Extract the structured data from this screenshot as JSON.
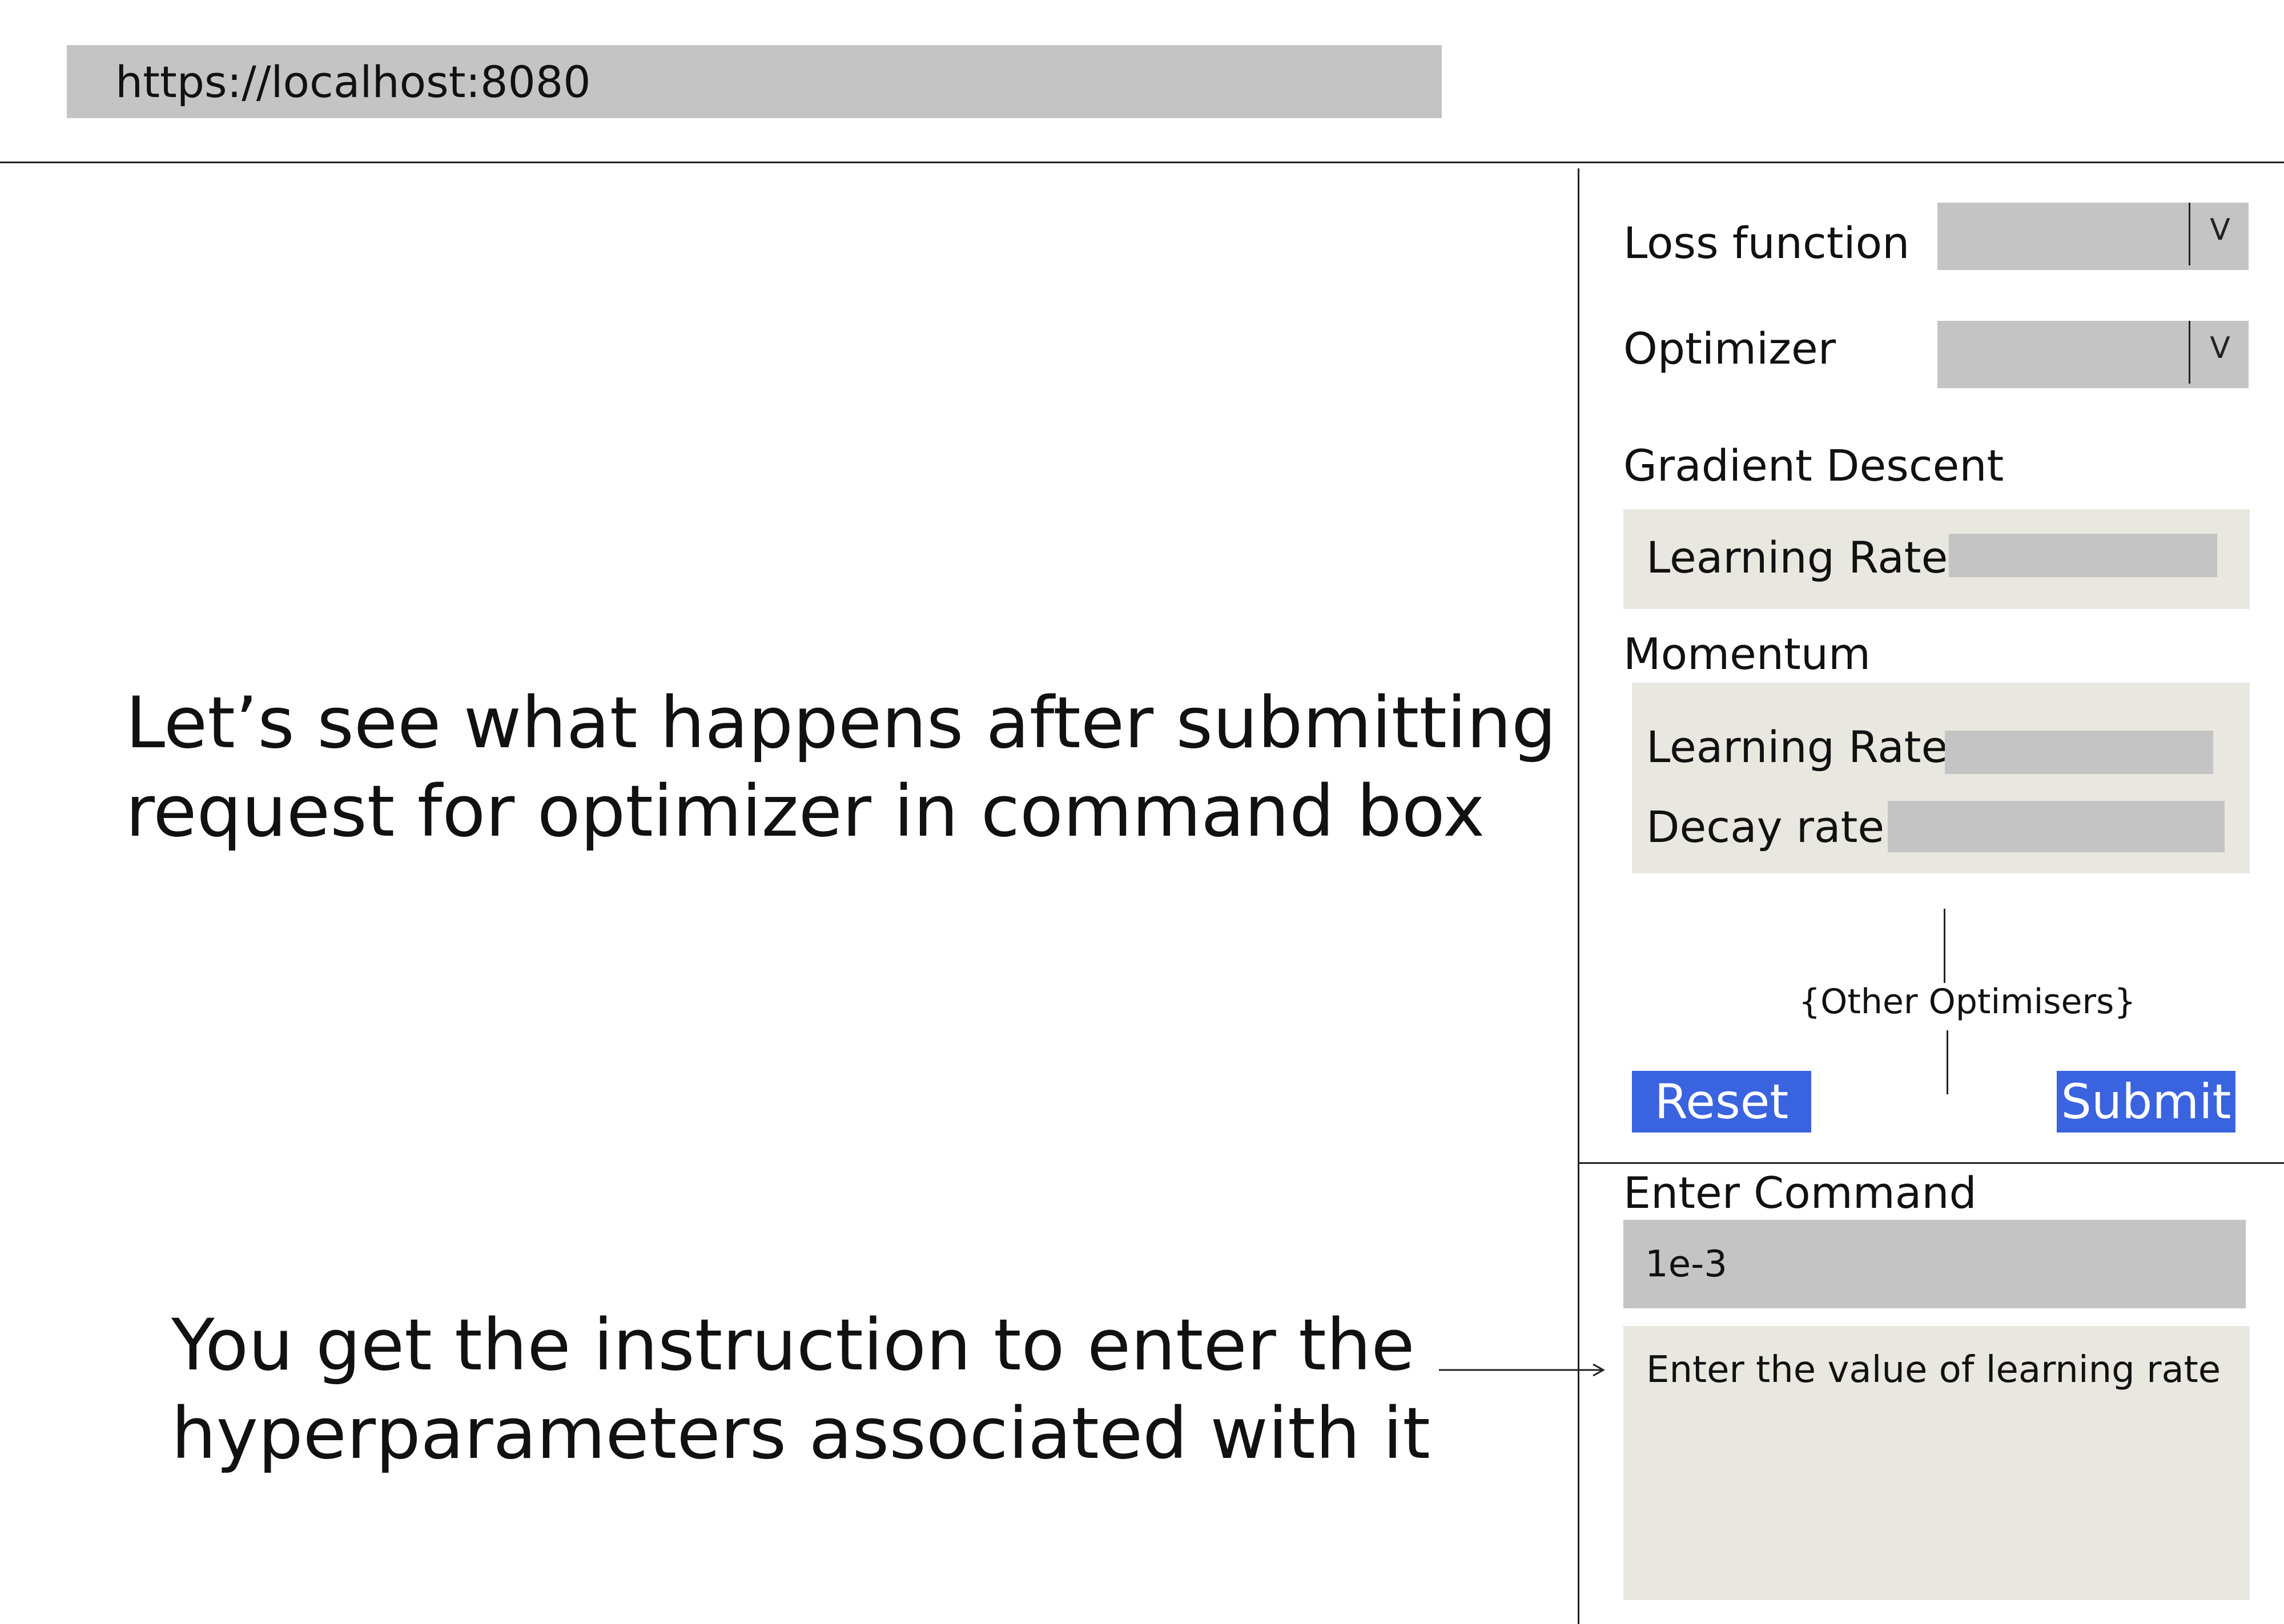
{
  "browser": {
    "url": "https://localhost:8080"
  },
  "annotations": {
    "top_line1": "Let’s see what happens after submitting",
    "top_line2": "request for optimizer in command box",
    "bottom_line1": "You get the instruction to enter the",
    "bottom_line2": "hyperparameters associated with it"
  },
  "sidebar": {
    "loss_function_label": "Loss function",
    "loss_function_chevron": "V",
    "optimizer_label": "Optimizer",
    "optimizer_chevron": "V",
    "gradient_descent": {
      "title": "Gradient Descent",
      "learning_rate_label": "Learning Rate"
    },
    "momentum": {
      "title": "Momentum",
      "learning_rate_label": "Learning Rate",
      "decay_rate_label": "Decay rate"
    },
    "other_optimisers": "{Other Optimisers}",
    "reset_label": "Reset",
    "submit_label": "Submit"
  },
  "command": {
    "title": "Enter Command",
    "input_value": "1e-3",
    "output_text": "Enter the value of learning rate"
  },
  "colors": {
    "button_blue": "#3a63df",
    "field_gray": "#c4c4c4",
    "panel_beige": "#e8e8e0"
  },
  "icons": {
    "arrow": "right-arrow-icon"
  }
}
